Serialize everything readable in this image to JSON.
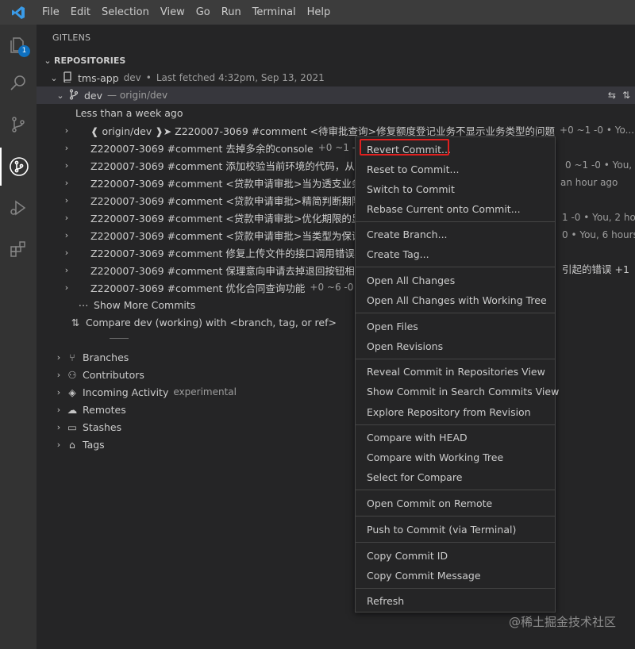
{
  "menu": [
    "File",
    "Edit",
    "Selection",
    "View",
    "Go",
    "Run",
    "Terminal",
    "Help"
  ],
  "activity": {
    "explorer_badge": "1"
  },
  "sidebar": {
    "title": "GITLENS",
    "section": "REPOSITORIES",
    "repo": {
      "name": "tms-app",
      "branch": "dev",
      "fetched": "Last fetched 4:32pm, Sep 13, 2021"
    },
    "branch": {
      "name": "dev",
      "upstream": "— origin/dev"
    },
    "group_label": "Less than a week ago",
    "commits": [
      {
        "msg": "❰ origin/dev ❱➤  Z220007-3069 #comment <待审批查询>修复额度登记业务不显示业务类型的问题",
        "meta": "+0 ~1 -0  •  Yo..."
      },
      {
        "msg": "Z220007-3069 #comment 去掉多余的console",
        "meta": "+0 ~1 -0"
      },
      {
        "msg": "Z220007-3069 #comment 添加校验当前环境的代码，从",
        "meta": "0 ~1 -0  •  You, an"
      },
      {
        "msg": "Z220007-3069 #comment <贷款申请审批>当为透支业务",
        "meta": "an hour ago"
      },
      {
        "msg": "Z220007-3069 #comment <贷款申请审批>精简判断期限",
        "meta": ""
      },
      {
        "msg": "Z220007-3069 #comment <贷款申请审批>优化期限的显",
        "meta": "1 -0  •  You, 2 hou"
      },
      {
        "msg": "Z220007-3069 #comment <贷款申请审批>当类型为保证",
        "meta": "0  •  You, 6 hours"
      },
      {
        "msg": "Z220007-3069 #comment 修复上传文件的接口调用错误",
        "meta": ""
      },
      {
        "msg": "Z220007-3069 #comment 保理意向申请去掉退回按钮相",
        "meta": "引起的错误  +1"
      },
      {
        "msg": "Z220007-3069 #comment 优化合同查询功能",
        "meta": "+0 ~6 -0  •"
      }
    ],
    "show_more": "Show More Commits",
    "compare": "Compare dev (working) with <branch, tag, or ref>",
    "sections": [
      {
        "label": "Branches",
        "tag": ""
      },
      {
        "label": "Contributors",
        "tag": ""
      },
      {
        "label": "Incoming Activity",
        "tag": "experimental"
      },
      {
        "label": "Remotes",
        "tag": ""
      },
      {
        "label": "Stashes",
        "tag": ""
      },
      {
        "label": "Tags",
        "tag": ""
      }
    ]
  },
  "context_menu": {
    "groups": [
      [
        "Revert Commit...",
        "Reset to Commit...",
        "Switch to Commit",
        "Rebase Current onto Commit..."
      ],
      [
        "Create Branch...",
        "Create Tag..."
      ],
      [
        "Open All Changes",
        "Open All Changes with Working Tree"
      ],
      [
        "Open Files",
        "Open Revisions"
      ],
      [
        "Reveal Commit in Repositories View",
        "Show Commit in Search Commits View",
        "Explore Repository from Revision"
      ],
      [
        "Compare with HEAD",
        "Compare with Working Tree",
        "Select for Compare"
      ],
      [
        "Open Commit on Remote"
      ],
      [
        "Push to Commit (via Terminal)"
      ],
      [
        "Copy Commit ID",
        "Copy Commit Message"
      ],
      [
        "Refresh"
      ]
    ]
  },
  "watermark": "@稀土掘金技术社区",
  "colors": {
    "accent": "#0e70c0",
    "highlight": "#e0201f",
    "selected_row": "#37373d"
  }
}
